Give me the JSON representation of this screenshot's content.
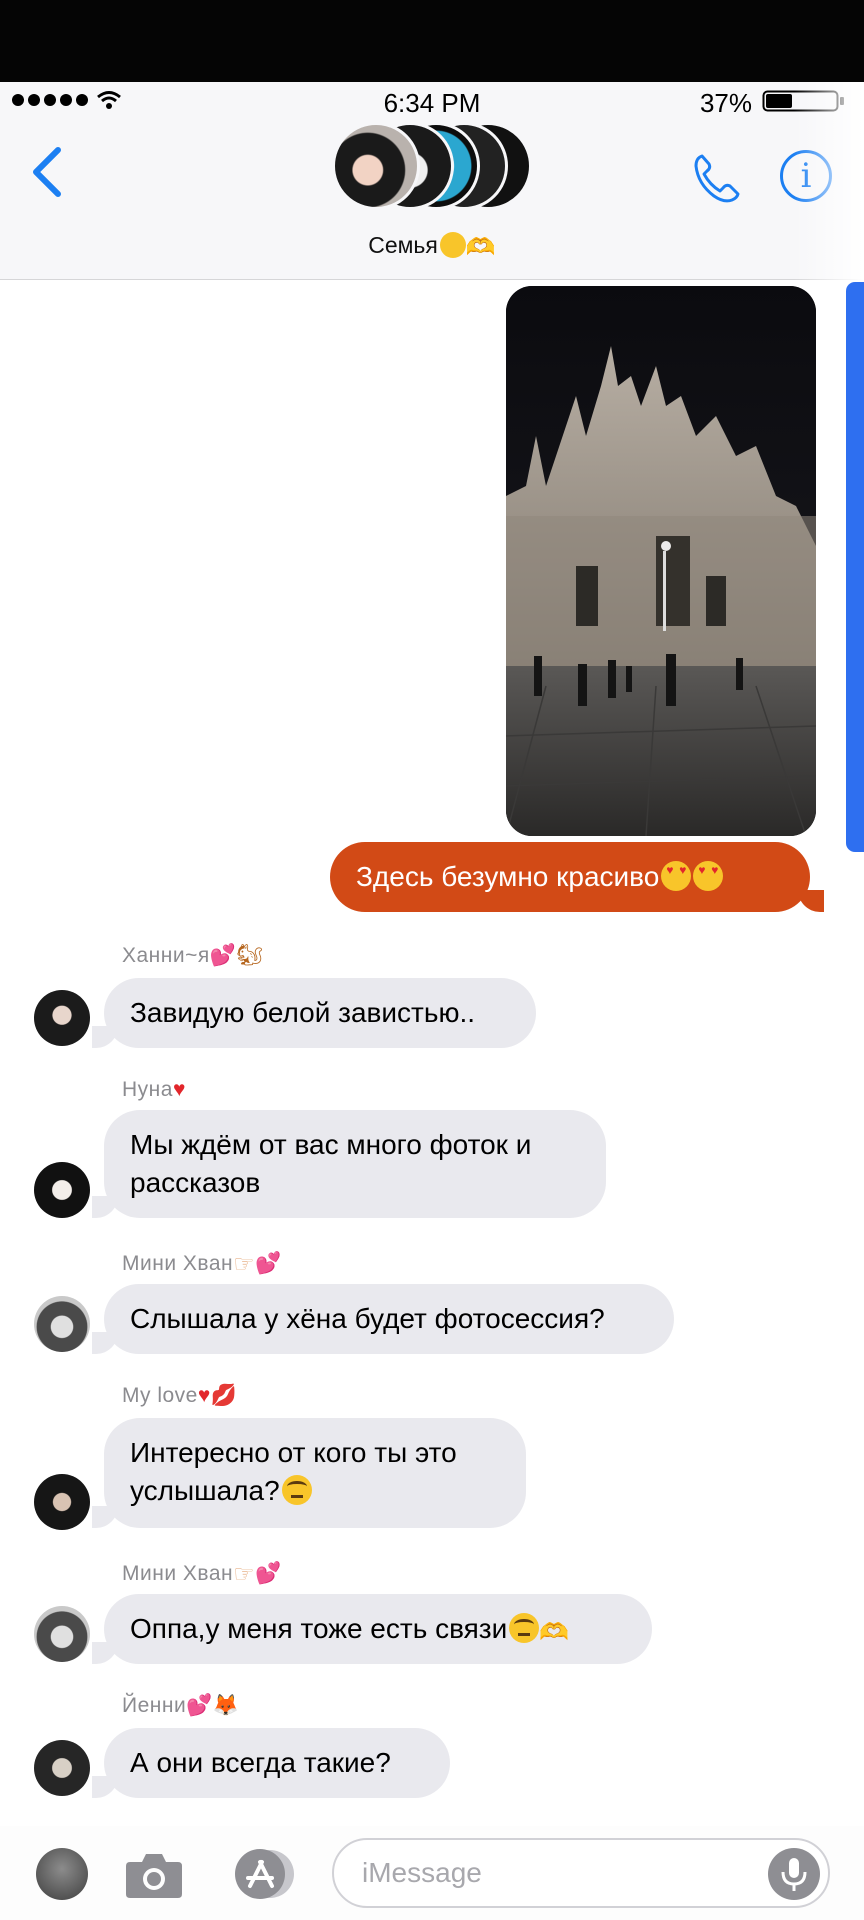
{
  "status_bar": {
    "time": "6:34 PM",
    "battery": "37%"
  },
  "header": {
    "group_name": "Семья😌🫶🏻",
    "group_name_text": "Семья"
  },
  "outgoing": {
    "text": "Здесь безумно красиво"
  },
  "messages": [
    {
      "sender": "Ханни~я",
      "text": "Завидую белой завистью..",
      "lines": [
        "Завидую белой завистью.."
      ]
    },
    {
      "sender": "Нуна",
      "lines": [
        "Мы ждём от вас много фоток и",
        "рассказов"
      ]
    },
    {
      "sender": "Мини Хван",
      "lines": [
        "Слышала у хёна будет фотосессия?"
      ]
    },
    {
      "sender": "My love",
      "lines": [
        "Интересно от кого ты это",
        "услышала?"
      ]
    },
    {
      "sender": "Мини Хван",
      "lines": [
        "Оппа,у меня тоже есть связи"
      ]
    },
    {
      "sender": "Йенни",
      "lines": [
        "А они всегда такие?"
      ]
    }
  ],
  "composer": {
    "placeholder": "iMessage"
  },
  "icons": {
    "back": "chevron-left-icon",
    "phone": "phone-icon",
    "info": "info-icon",
    "camera": "camera-icon",
    "apps": "app-store-icon",
    "mic": "microphone-icon"
  },
  "colors": {
    "accent": "#1c7ff2",
    "outgoing_bubble": "#d24a16",
    "incoming_bubble": "#e9e9ee",
    "scroll_indicator": "#2e6ff0"
  }
}
